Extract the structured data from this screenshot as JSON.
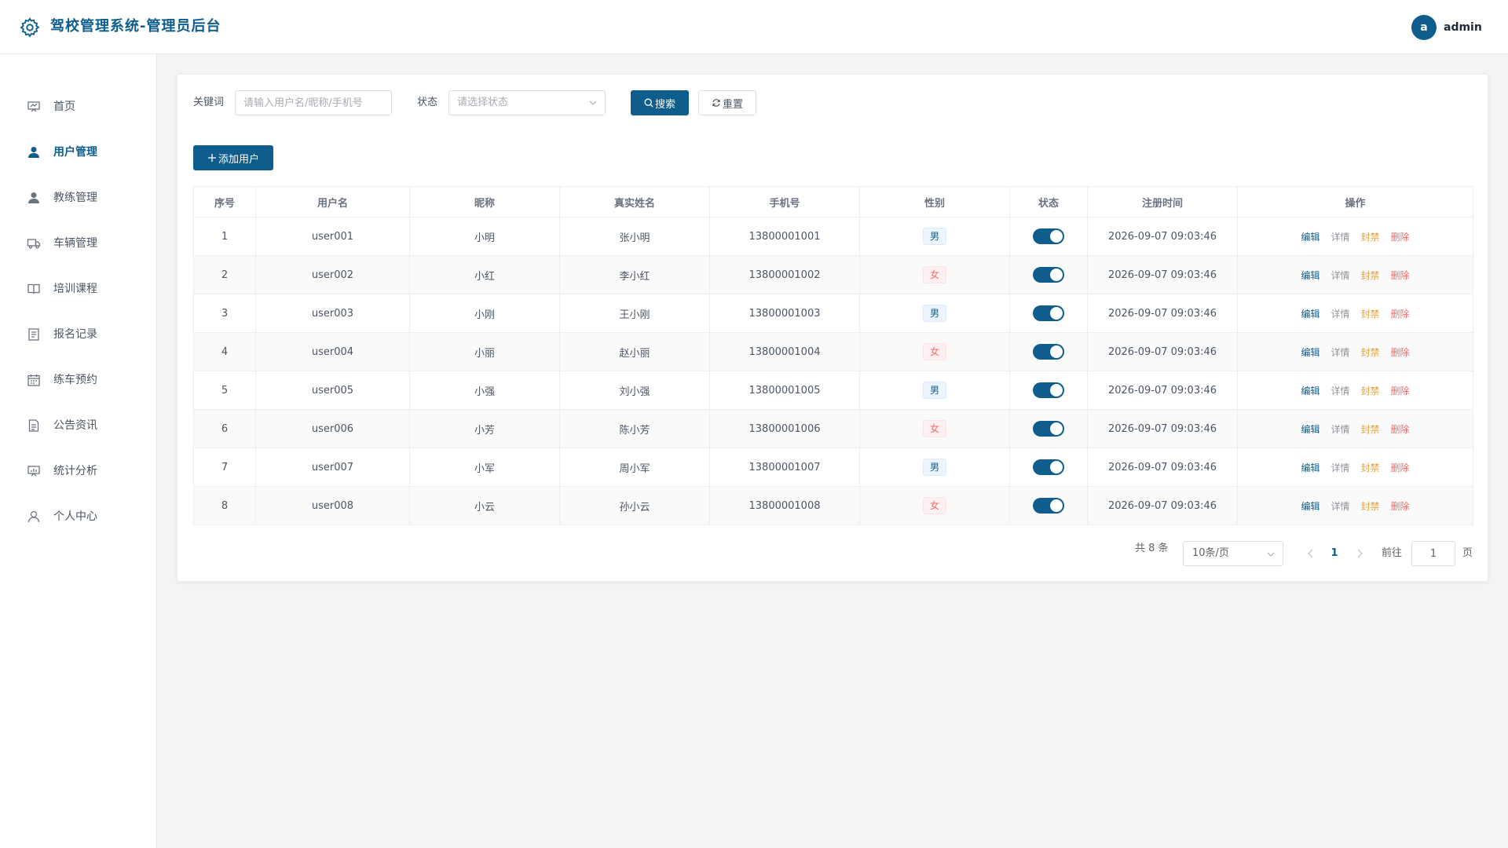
{
  "header": {
    "title": "驾校管理系统-管理员后台",
    "avatar_letter": "a",
    "username": "admin",
    "logo_icon": "gear-icon"
  },
  "sidebar": {
    "items": [
      {
        "label": "首页",
        "icon": "dashboard-icon",
        "active": false
      },
      {
        "label": "用户管理",
        "icon": "user-icon",
        "active": true
      },
      {
        "label": "教练管理",
        "icon": "coach-icon",
        "active": false
      },
      {
        "label": "车辆管理",
        "icon": "truck-icon",
        "active": false
      },
      {
        "label": "培训课程",
        "icon": "book-icon",
        "active": false
      },
      {
        "label": "报名记录",
        "icon": "document-icon",
        "active": false
      },
      {
        "label": "练车预约",
        "icon": "calendar-icon",
        "active": false
      },
      {
        "label": "公告资讯",
        "icon": "notice-icon",
        "active": false
      },
      {
        "label": "统计分析",
        "icon": "chart-icon",
        "active": false
      },
      {
        "label": "个人中心",
        "icon": "profile-icon",
        "active": false
      }
    ]
  },
  "search": {
    "keyword_label": "关键词",
    "keyword_placeholder": "请输入用户名/昵称/手机号",
    "status_label": "状态",
    "status_placeholder": "请选择状态",
    "search_button": "搜索",
    "reset_button": "重置"
  },
  "toolbar": {
    "add_button": "添加用户"
  },
  "table": {
    "columns": [
      "序号",
      "用户名",
      "昵称",
      "真实姓名",
      "手机号",
      "性别",
      "状态",
      "注册时间",
      "操作"
    ],
    "actions": {
      "edit": "编辑",
      "detail": "详情",
      "ban": "封禁",
      "delete": "删除"
    },
    "rows": [
      {
        "index": "1",
        "username": "user001",
        "nickname": "小明",
        "real_name": "张小明",
        "phone": "13800001001",
        "gender": "男",
        "enabled": true,
        "registered": "2026-09-07 09:03:46"
      },
      {
        "index": "2",
        "username": "user002",
        "nickname": "小红",
        "real_name": "李小红",
        "phone": "13800001002",
        "gender": "女",
        "enabled": true,
        "registered": "2026-09-07 09:03:46"
      },
      {
        "index": "3",
        "username": "user003",
        "nickname": "小刚",
        "real_name": "王小刚",
        "phone": "13800001003",
        "gender": "男",
        "enabled": true,
        "registered": "2026-09-07 09:03:46"
      },
      {
        "index": "4",
        "username": "user004",
        "nickname": "小丽",
        "real_name": "赵小丽",
        "phone": "13800001004",
        "gender": "女",
        "enabled": true,
        "registered": "2026-09-07 09:03:46"
      },
      {
        "index": "5",
        "username": "user005",
        "nickname": "小强",
        "real_name": "刘小强",
        "phone": "13800001005",
        "gender": "男",
        "enabled": true,
        "registered": "2026-09-07 09:03:46"
      },
      {
        "index": "6",
        "username": "user006",
        "nickname": "小芳",
        "real_name": "陈小芳",
        "phone": "13800001006",
        "gender": "女",
        "enabled": true,
        "registered": "2026-09-07 09:03:46"
      },
      {
        "index": "7",
        "username": "user007",
        "nickname": "小军",
        "real_name": "周小军",
        "phone": "13800001007",
        "gender": "男",
        "enabled": true,
        "registered": "2026-09-07 09:03:46"
      },
      {
        "index": "8",
        "username": "user008",
        "nickname": "小云",
        "real_name": "孙小云",
        "phone": "13800001008",
        "gender": "女",
        "enabled": true,
        "registered": "2026-09-07 09:03:46"
      }
    ]
  },
  "pagination": {
    "total_text": "共 8 条",
    "page_size": "10条/页",
    "current_page": "1",
    "goto_label": "前往",
    "goto_value": "1",
    "page_suffix": "页"
  },
  "colors": {
    "primary": "#0e5d8c",
    "warning": "#e6a23c",
    "danger": "#f56c6c",
    "muted": "#909399"
  }
}
